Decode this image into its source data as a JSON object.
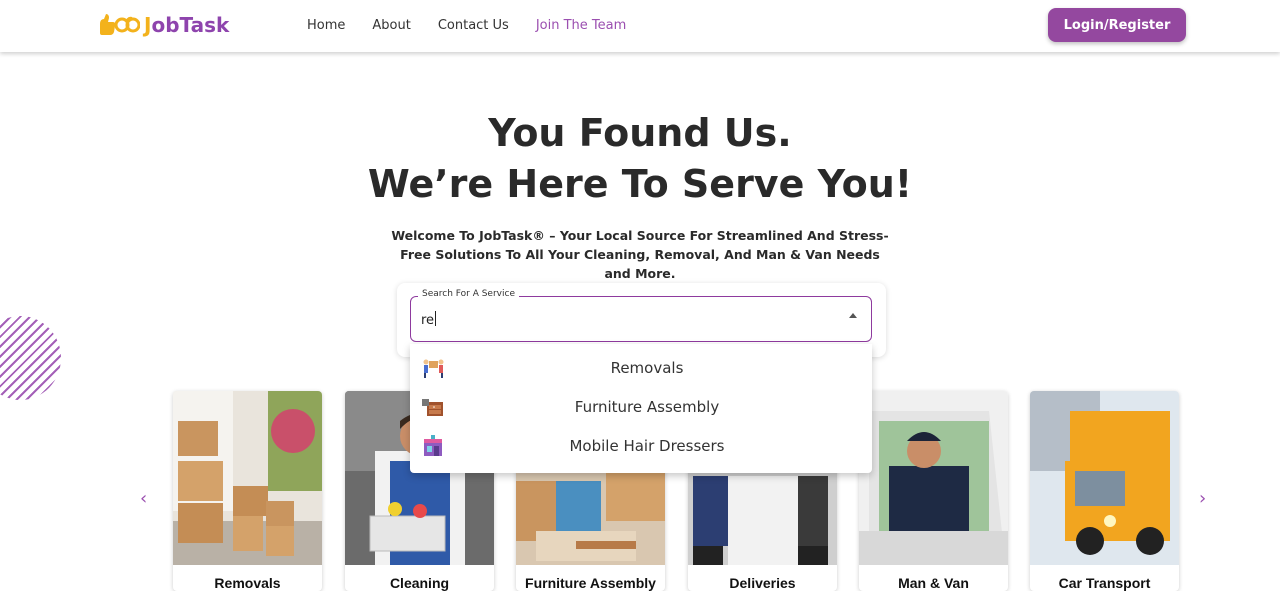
{
  "header": {
    "logo_text_j": "J",
    "logo_text_ob": "ob",
    "logo_text_task": "Task",
    "nav": [
      {
        "label": "Home",
        "active": false
      },
      {
        "label": "About",
        "active": false
      },
      {
        "label": "Contact Us",
        "active": false
      },
      {
        "label": "Join The Team",
        "active": true
      }
    ],
    "login_label": "Login/Register"
  },
  "hero": {
    "title_line1": "You Found Us.",
    "title_line2": "We’re Here To Serve You!",
    "subtitle": "Welcome To JobTask® – Your Local Source For Streamlined And Stress-Free Solutions To All Your Cleaning, Removal, And Man & Van Needs and More."
  },
  "search": {
    "legend": "Search For A Service",
    "value": "re",
    "options": [
      {
        "label": "Removals",
        "icon": "movers-icon"
      },
      {
        "label": "Furniture Assembly",
        "icon": "furniture-icon"
      },
      {
        "label": "Mobile Hair Dressers",
        "icon": "hair-salon-icon"
      }
    ]
  },
  "carousel": {
    "prev_icon": "‹",
    "next_icon": "›",
    "cards": [
      {
        "title": "Removals",
        "image": "boxes-photo"
      },
      {
        "title": "Cleaning",
        "image": "cleaner-photo"
      },
      {
        "title": "Furniture Assembly",
        "image": "assembly-photo"
      },
      {
        "title": "Deliveries",
        "image": "delivery-photo"
      },
      {
        "title": "Man & Van",
        "image": "van-driver-photo"
      },
      {
        "title": "Car Transport",
        "image": "tow-truck-photo"
      }
    ]
  },
  "colors": {
    "brand_purple": "#94489f",
    "brand_yellow": "#f3b21c",
    "text_dark": "#2a2a2a"
  }
}
